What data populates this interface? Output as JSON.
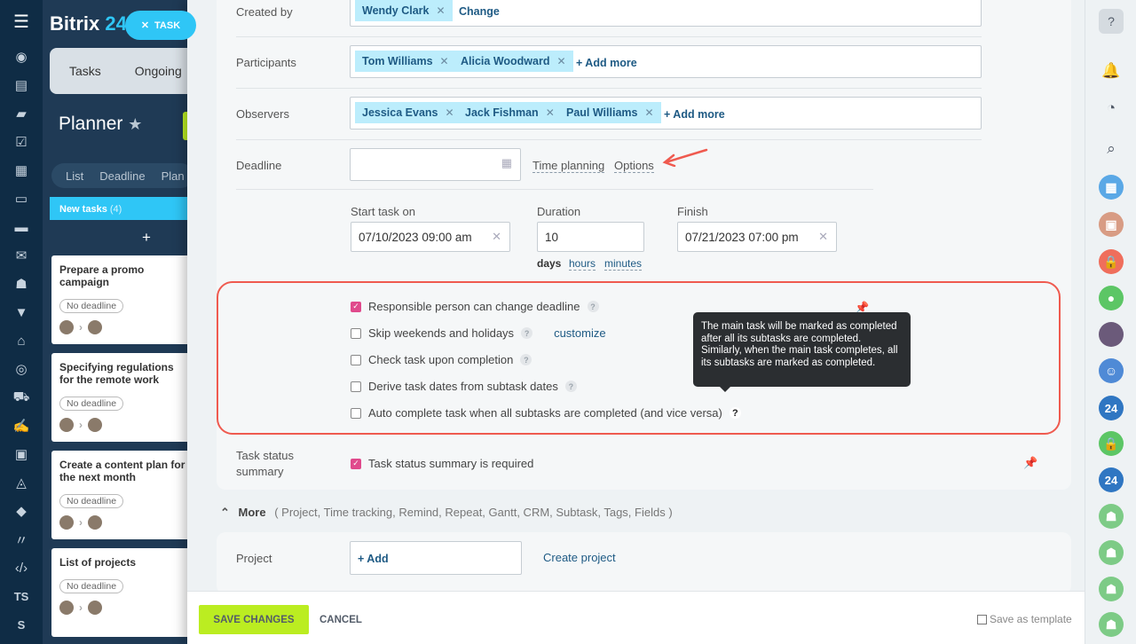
{
  "app": {
    "logo_text": "Bitrix",
    "logo_suffix": "24",
    "task_pill": "TASK"
  },
  "background": {
    "tabs": [
      "Tasks",
      "Ongoing"
    ],
    "title": "Planner",
    "views": [
      "List",
      "Deadline",
      "Plan"
    ],
    "column": {
      "name": "New tasks",
      "count": "(4)"
    },
    "cards": [
      {
        "title": "Prepare a promo campaign",
        "badge": "No deadline"
      },
      {
        "title": "Specifying regulations for the remote work",
        "badge": "No deadline"
      },
      {
        "title": "Create a content plan for the next month",
        "badge": "No deadline"
      },
      {
        "title": "List of projects",
        "badge": "No deadline"
      }
    ],
    "nav_text": [
      "TS",
      "S"
    ]
  },
  "form": {
    "created_by": {
      "label": "Created by",
      "chip": "Wendy Clark",
      "link": "Change"
    },
    "participants": {
      "label": "Participants",
      "chips": [
        "Tom Williams",
        "Alicia Woodward"
      ],
      "add": "+ Add more"
    },
    "observers": {
      "label": "Observers",
      "chips": [
        "Jessica Evans",
        "Jack Fishman",
        "Paul Williams"
      ],
      "add": "+ Add more"
    },
    "deadline": {
      "label": "Deadline",
      "value": "",
      "time_planning": "Time planning",
      "options": "Options"
    },
    "start": {
      "label": "Start task on",
      "value": "07/10/2023 09:00 am"
    },
    "duration": {
      "label": "Duration",
      "value": "10",
      "units": [
        "days",
        "hours",
        "minutes"
      ]
    },
    "finish": {
      "label": "Finish",
      "value": "07/21/2023 07:00 pm"
    },
    "options": {
      "responsible_change": {
        "label": "Responsible person can change deadline",
        "checked": true
      },
      "skip_weekends": {
        "label": "Skip weekends and holidays",
        "checked": false,
        "link": "customize"
      },
      "check_upon": {
        "label": "Check task upon completion",
        "checked": false
      },
      "derive_dates": {
        "label": "Derive task dates from subtask dates",
        "checked": false
      },
      "auto_complete": {
        "label": "Auto complete task when all subtasks are completed (and vice versa)",
        "checked": false
      }
    },
    "tooltip": "The main task will be marked as completed after all its subtasks are completed. Similarly, when the main task completes, all its subtasks are marked as completed.",
    "status_summary": {
      "label": "Task status summary",
      "checkbox": "Task status summary is required",
      "checked": true
    },
    "more": {
      "label": "More",
      "items": "( Project,  Time tracking,  Remind,  Repeat,  Gantt,  CRM,  Subtask,  Tags,  Fields )"
    },
    "project": {
      "label": "Project",
      "add": "+ Add",
      "create": "Create project"
    }
  },
  "footer": {
    "save": "SAVE CHANGES",
    "cancel": "CANCEL",
    "template": "Save as template"
  },
  "rightbar": {
    "badge_text": "24"
  },
  "colors": {
    "accent_green": "#bbed21",
    "chip_bg": "#bcedfc",
    "highlight_red": "#ef5a4f",
    "checkbox_pink": "#e04a8c"
  }
}
